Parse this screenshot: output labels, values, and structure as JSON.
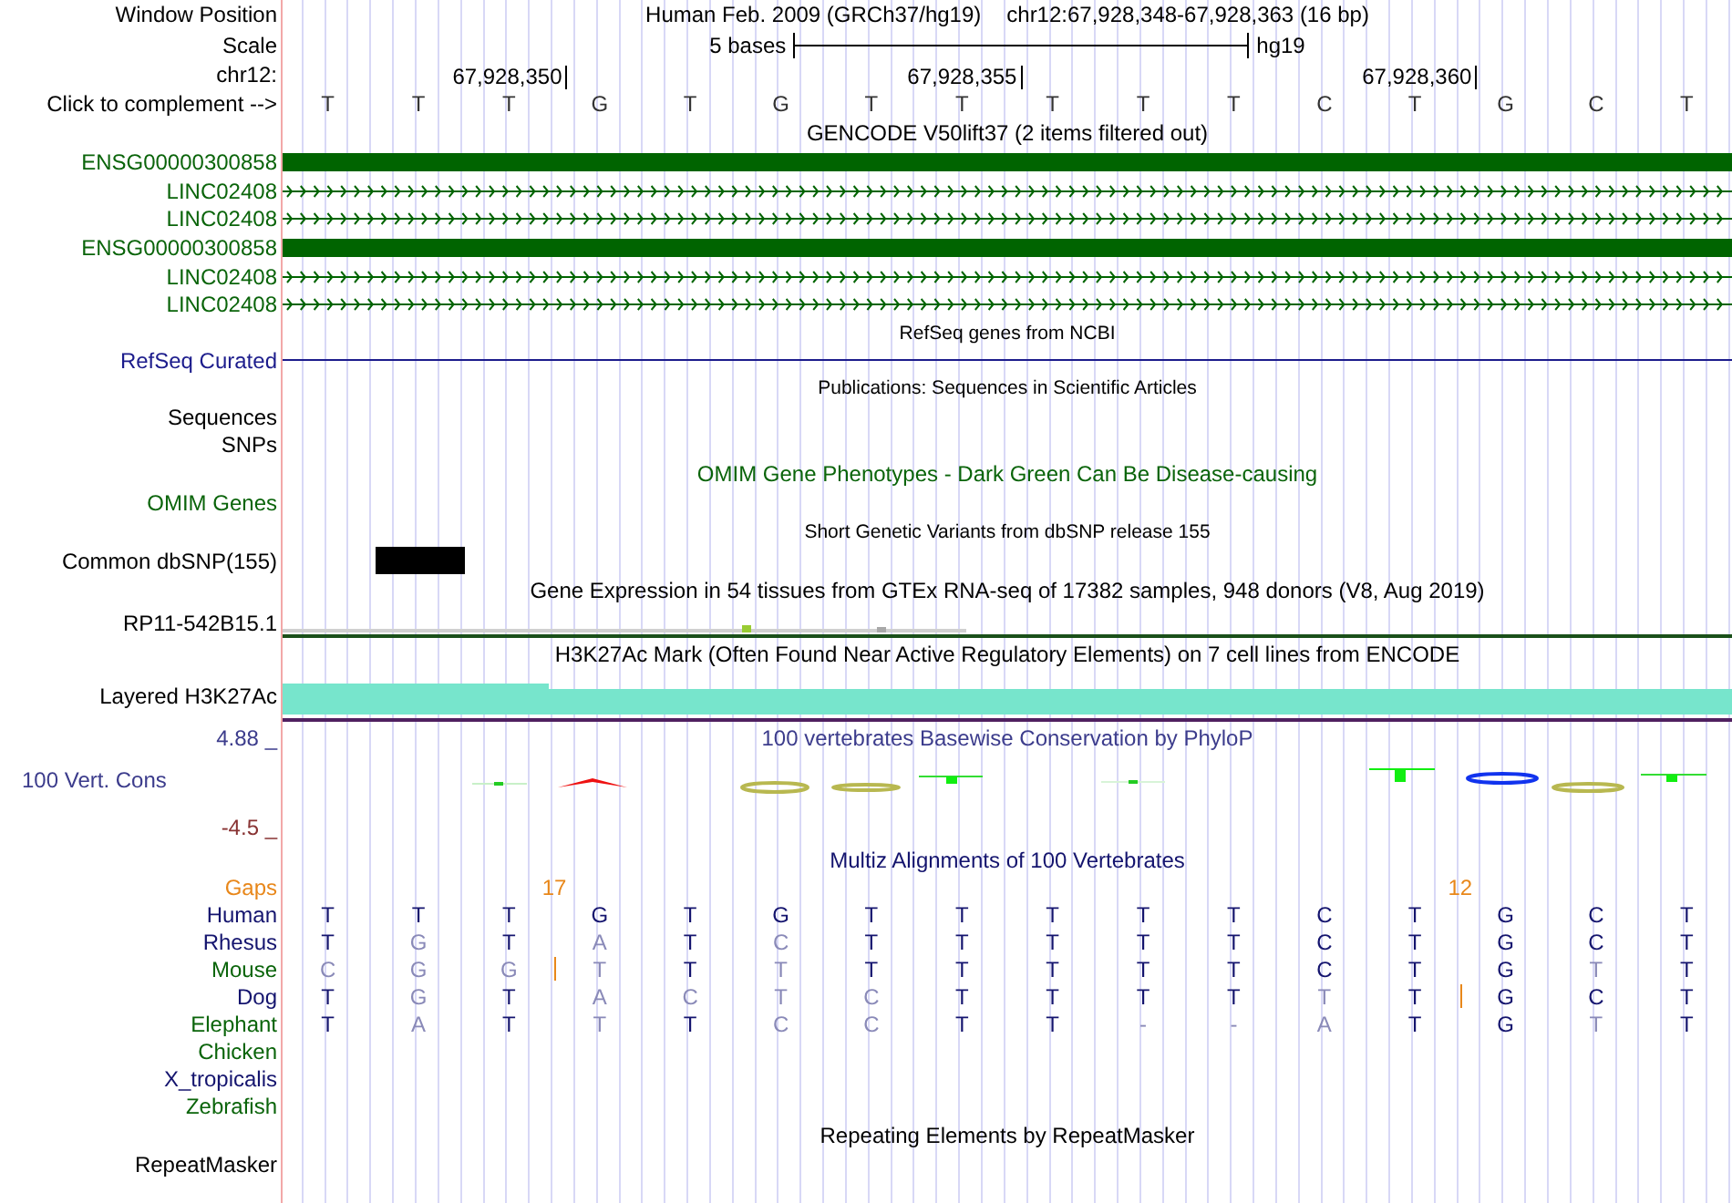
{
  "labels": {
    "window_position": "Window Position",
    "scale": "Scale",
    "chromosome": "chr12:",
    "complement": "Click to complement -->"
  },
  "window": {
    "assembly": "Human Feb. 2009 (GRCh37/hg19)",
    "position": "chr12:67,928,348-67,928,363 (16 bp)"
  },
  "scale": {
    "length": "5 bases",
    "assembly": "hg19"
  },
  "reference": [
    {
      "base": "T"
    },
    {
      "base": "T"
    },
    {
      "base": "T",
      "tick": "67,928,350"
    },
    {
      "base": "G",
      "gap": "17"
    },
    {
      "base": "T"
    },
    {
      "base": "G"
    },
    {
      "base": "T"
    },
    {
      "base": "T",
      "tick": "67,928,355"
    },
    {
      "base": "T"
    },
    {
      "base": "T"
    },
    {
      "base": "T"
    },
    {
      "base": "C"
    },
    {
      "base": "T",
      "tick": "67,928,360"
    },
    {
      "base": "G",
      "gap": "12"
    },
    {
      "base": "C"
    },
    {
      "base": "T"
    }
  ],
  "tracks": [
    {
      "kind": "genes",
      "title": "GENCODE V50lift37 (2 items filtered out)",
      "items": [
        {
          "label": "ENSG00000300858",
          "kind": "block"
        },
        {
          "label": "LINC02408",
          "kind": "arrows"
        },
        {
          "label": "LINC02408",
          "kind": "arrows"
        },
        {
          "label": "ENSG00000300858",
          "kind": "block"
        },
        {
          "label": "LINC02408",
          "kind": "arrows"
        },
        {
          "label": "LINC02408",
          "kind": "arrows"
        }
      ]
    },
    {
      "kind": "line",
      "title": "RefSeq genes from NCBI",
      "label": "RefSeq Curated",
      "color": "#1c1c8c"
    },
    {
      "kind": "labels_only",
      "title": "Publications: Sequences in Scientific Articles",
      "labels": [
        "Sequences",
        "SNPs"
      ]
    },
    {
      "kind": "empty",
      "title": "OMIM Gene Phenotypes - Dark Green Can Be Disease-causing",
      "label": "OMIM Genes",
      "color": "#0a640a"
    },
    {
      "kind": "snp",
      "title": "Short Genetic Variants from dbSNP release 155",
      "label": "Common dbSNP(155)"
    },
    {
      "kind": "expression",
      "title": "Gene Expression in 54 tissues from GTEx RNA-seq of 17382 samples, 948 donors (V8, Aug 2019)",
      "label": "RP11-542B15.1"
    },
    {
      "kind": "signal",
      "title": "H3K27Ac Mark (Often Found Near Active Regulatory Elements) on 7 cell lines from ENCODE",
      "label": "Layered H3K27Ac"
    },
    {
      "kind": "conservation",
      "title": "100 vertebrates Basewise Conservation by PhyloP",
      "label": "100 Vert. Cons",
      "color": "#3c3c8c",
      "max": "4.88 _",
      "min": "-4.5 _"
    },
    {
      "kind": "alignment",
      "title": "Multiz Alignments of 100 Vertebrates",
      "color": "#14146e",
      "gaps_label": "Gaps",
      "species": [
        {
          "name": "Human",
          "color": "#14146e",
          "bases": [
            {
              "base": "T",
              "match": true
            },
            {
              "base": "T",
              "match": true
            },
            {
              "base": "T",
              "match": true
            },
            {
              "base": "G",
              "match": true
            },
            {
              "base": "T",
              "match": true
            },
            {
              "base": "G",
              "match": true
            },
            {
              "base": "T",
              "match": true
            },
            {
              "base": "T",
              "match": true
            },
            {
              "base": "T",
              "match": true
            },
            {
              "base": "T",
              "match": true
            },
            {
              "base": "T",
              "match": true
            },
            {
              "base": "C",
              "match": true
            },
            {
              "base": "T",
              "match": true
            },
            {
              "base": "G",
              "match": true
            },
            {
              "base": "C",
              "match": true
            },
            {
              "base": "T",
              "match": true
            }
          ]
        },
        {
          "name": "Rhesus",
          "color": "#14146e",
          "bases": [
            {
              "base": "T",
              "match": true
            },
            {
              "base": "G",
              "match": false
            },
            {
              "base": "T",
              "match": true
            },
            {
              "base": "A",
              "match": false
            },
            {
              "base": "T",
              "match": true
            },
            {
              "base": "C",
              "match": false
            },
            {
              "base": "T",
              "match": true
            },
            {
              "base": "T",
              "match": true
            },
            {
              "base": "T",
              "match": true
            },
            {
              "base": "T",
              "match": true
            },
            {
              "base": "T",
              "match": true
            },
            {
              "base": "C",
              "match": true
            },
            {
              "base": "T",
              "match": true
            },
            {
              "base": "G",
              "match": true
            },
            {
              "base": "C",
              "match": true
            },
            {
              "base": "T",
              "match": true
            }
          ]
        },
        {
          "name": "Mouse",
          "color": "#0a640a",
          "bases": [
            {
              "base": "C",
              "match": false
            },
            {
              "base": "G",
              "match": false
            },
            {
              "base": "G",
              "match": false
            },
            {
              "base": "T",
              "match": false,
              "insert": true
            },
            {
              "base": "T",
              "match": true
            },
            {
              "base": "T",
              "match": false
            },
            {
              "base": "T",
              "match": true
            },
            {
              "base": "T",
              "match": true
            },
            {
              "base": "T",
              "match": true
            },
            {
              "base": "T",
              "match": true
            },
            {
              "base": "T",
              "match": true
            },
            {
              "base": "C",
              "match": true
            },
            {
              "base": "T",
              "match": true
            },
            {
              "base": "G",
              "match": true
            },
            {
              "base": "T",
              "match": false
            },
            {
              "base": "T",
              "match": true
            }
          ]
        },
        {
          "name": "Dog",
          "color": "#14146e",
          "bases": [
            {
              "base": "T",
              "match": true
            },
            {
              "base": "G",
              "match": false
            },
            {
              "base": "T",
              "match": true
            },
            {
              "base": "A",
              "match": false
            },
            {
              "base": "C",
              "match": false
            },
            {
              "base": "T",
              "match": false
            },
            {
              "base": "C",
              "match": false
            },
            {
              "base": "T",
              "match": true
            },
            {
              "base": "T",
              "match": true
            },
            {
              "base": "T",
              "match": true
            },
            {
              "base": "T",
              "match": true
            },
            {
              "base": "T",
              "match": false
            },
            {
              "base": "T",
              "match": true
            },
            {
              "base": "G",
              "match": true,
              "insert": true
            },
            {
              "base": "C",
              "match": true
            },
            {
              "base": "T",
              "match": true
            }
          ]
        },
        {
          "name": "Elephant",
          "color": "#0a640a",
          "bases": [
            {
              "base": "T",
              "match": true
            },
            {
              "base": "A",
              "match": false
            },
            {
              "base": "T",
              "match": true
            },
            {
              "base": "T",
              "match": false
            },
            {
              "base": "T",
              "match": true
            },
            {
              "base": "C",
              "match": false
            },
            {
              "base": "C",
              "match": false
            },
            {
              "base": "T",
              "match": true
            },
            {
              "base": "T",
              "match": true
            },
            {
              "base": "-",
              "match": false
            },
            {
              "base": "-",
              "match": false
            },
            {
              "base": "A",
              "match": false
            },
            {
              "base": "T",
              "match": true
            },
            {
              "base": "G",
              "match": true
            },
            {
              "base": "T",
              "match": false
            },
            {
              "base": "T",
              "match": true
            }
          ]
        },
        {
          "name": "Chicken",
          "color": "#0a640a"
        },
        {
          "name": "X_tropicalis",
          "color": "#14146e"
        },
        {
          "name": "Zebrafish",
          "color": "#0a640a"
        }
      ]
    },
    {
      "kind": "empty",
      "title": "Repeating Elements by RepeatMasker",
      "label": "RepeatMasker"
    }
  ]
}
